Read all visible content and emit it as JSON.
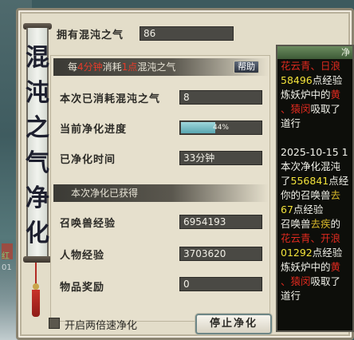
{
  "title": "混沌之气净化",
  "owned": {
    "label": "拥有混沌之气",
    "value": "86"
  },
  "consume_header": {
    "prefix": "每",
    "minutes": "4分钟",
    "mid": "消耗",
    "amount": "1点",
    "suffix": "混沌之气",
    "help_label": "帮助"
  },
  "rows": {
    "consumed": {
      "label": "本次已消耗混沌之气",
      "value": "8"
    },
    "progress": {
      "label": "当前净化进度",
      "text": "44%",
      "fraction": 0.44
    },
    "time": {
      "label": "已净化时间",
      "value": "33分钟"
    }
  },
  "gained_header": "本次净化已获得",
  "gains": {
    "pet_exp": {
      "label": "召唤兽经验",
      "value": "6954193"
    },
    "char_exp": {
      "label": "人物经验",
      "value": "3703620"
    },
    "items": {
      "label": "物品奖励",
      "value": "0"
    }
  },
  "double_speed": {
    "label": "开启两倍速净化",
    "checked": false
  },
  "stop_button": "停止净化",
  "log": {
    "title": "净",
    "lines": [
      {
        "segments": [
          {
            "t": "花云青、日浪",
            "c": "r"
          }
        ]
      },
      {
        "segments": [
          {
            "t": "58496",
            "c": "y"
          },
          {
            "t": "点经验",
            "c": "w"
          }
        ]
      },
      {
        "segments": [
          {
            "t": "炼妖炉中的",
            "c": "w"
          },
          {
            "t": "黄",
            "c": "r"
          }
        ]
      },
      {
        "segments": [
          {
            "t": "、猿闵",
            "c": "r"
          },
          {
            "t": "吸取了",
            "c": "w"
          }
        ]
      },
      {
        "segments": [
          {
            "t": "道行",
            "c": "w"
          }
        ]
      },
      {
        "segments": [
          {
            "t": "",
            "c": "w"
          }
        ]
      },
      {
        "segments": [
          {
            "t": "2025-10-15 1",
            "c": "w"
          }
        ]
      },
      {
        "segments": [
          {
            "t": "本次净化混沌",
            "c": "w"
          }
        ]
      },
      {
        "segments": [
          {
            "t": "了",
            "c": "w"
          },
          {
            "t": "556841",
            "c": "y"
          },
          {
            "t": "点经",
            "c": "w"
          }
        ]
      },
      {
        "segments": [
          {
            "t": "你的召唤兽",
            "c": "w"
          },
          {
            "t": "去",
            "c": "g"
          }
        ]
      },
      {
        "segments": [
          {
            "t": "67",
            "c": "y"
          },
          {
            "t": "点经验",
            "c": "w"
          }
        ]
      },
      {
        "segments": [
          {
            "t": "召唤兽",
            "c": "w"
          },
          {
            "t": "去疾",
            "c": "g"
          },
          {
            "t": "的",
            "c": "w"
          }
        ]
      },
      {
        "segments": [
          {
            "t": "花云青、开浪",
            "c": "r"
          }
        ]
      },
      {
        "segments": [
          {
            "t": "01292",
            "c": "y"
          },
          {
            "t": "点经验",
            "c": "w"
          }
        ]
      },
      {
        "segments": [
          {
            "t": "炼妖炉中的",
            "c": "w"
          },
          {
            "t": "黄",
            "c": "r"
          }
        ]
      },
      {
        "segments": [
          {
            "t": "、猿闵",
            "c": "r"
          },
          {
            "t": "吸取了",
            "c": "w"
          }
        ]
      },
      {
        "segments": [
          {
            "t": "道行",
            "c": "w"
          }
        ]
      }
    ]
  },
  "background": {
    "left_text_1": "红",
    "left_text_2": "01"
  }
}
